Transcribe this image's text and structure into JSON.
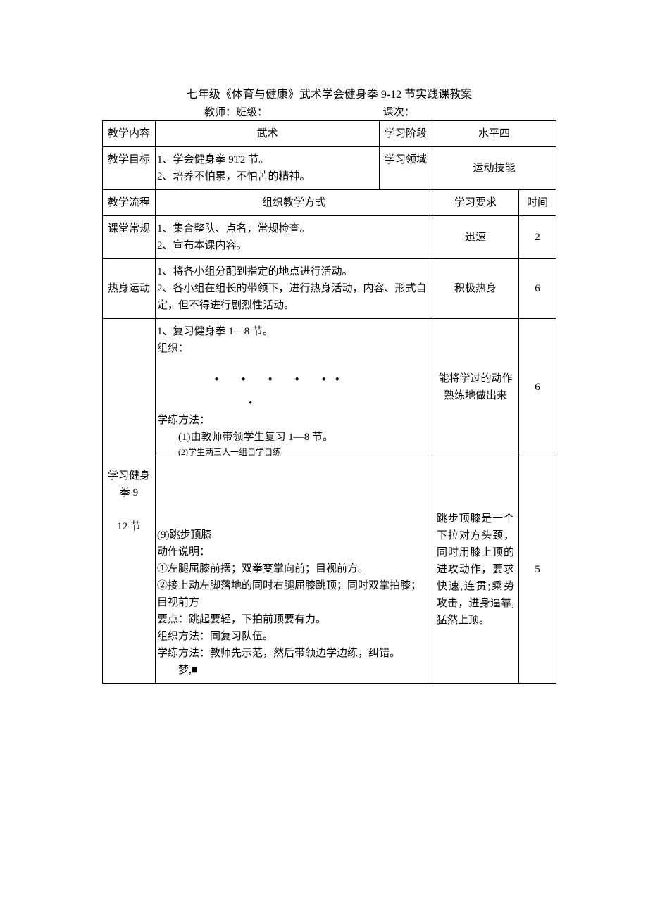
{
  "doc_title": "七年级《体育与健康》武术学会健身拳 9-12 节实践课教案",
  "subtitle": {
    "left": "教师：班级：",
    "right": "课次："
  },
  "labels": {
    "teach_content": "教学内容",
    "study_stage": "学习阶段",
    "teach_goal": "教学目标",
    "study_field": "学习领域",
    "teach_flow": "教学流程",
    "org_method": "组织教学方式",
    "study_req": "学习要求",
    "time": "时间",
    "class_routine": "课堂常规",
    "warmup": "热身运动",
    "learn_quan": "学习健身拳 9\n\n12 节"
  },
  "values": {
    "wushu": "武术",
    "level4": "水平四",
    "goal_lines": "1、学会健身拳 9T2 节。\n2、培养不怕累，不怕苦的精神。",
    "skill": "运动技能",
    "routine_lines": "1、集合整队、点名，常规检查。\n2、宣布本课内容。",
    "routine_req": "迅速",
    "routine_time": "2",
    "warmup_lines": "1、将各小组分配到指定的地点进行活动。\n2、各小组在组长的带领下，进行热身活动，内容、形式自定，但不得进行剧烈性活动。",
    "warmup_req": "积极热身",
    "warmup_time": "6",
    "review_head": "1、复习健身拳 1—8 节。",
    "review_org": "组织：",
    "review_method_label": "学练方法：",
    "review_method_1": "(1)由教师带领学生复习 1—8 节。",
    "review_method_2_trunc": "(2)学生两三人一组自学自练",
    "review_req": "能将学过的动作熟练地做出来",
    "review_time": "6",
    "move9_title": "(9)跳步顶膝",
    "move9_desc_label": "动作说明：",
    "move9_line1": "①左腿屈膝前摆；双拳变掌向前；目视前方。",
    "move9_line2": "②接上动左脚落地的同时右腿屈膝跳顶；同时双掌拍膝；目视前方",
    "move9_point": "要点：跳起要轻，下拍前顶要有力。",
    "move9_org": "组织方法：同复习队伍。",
    "move9_learn": "学练方法：教师先示范，然后带领边学边练，纠错。",
    "move9_bottom": "梦,■",
    "move9_req": "跳步顶膝是一个下拉对方头颈，同时用膝上顶的进攻动作，要求快速,连贯;乘势攻击，进身逼靠,猛然上顶。",
    "move9_time": "5"
  }
}
